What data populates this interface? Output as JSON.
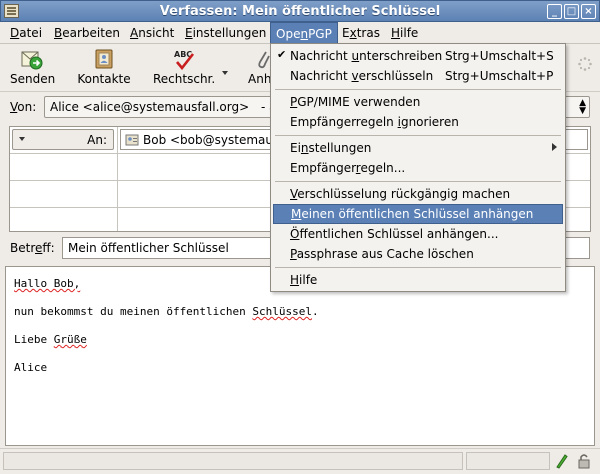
{
  "window": {
    "title": "Verfassen: Mein öffentlicher Schlüssel"
  },
  "menubar": {
    "items": [
      {
        "pre": "",
        "mn": "D",
        "post": "atei"
      },
      {
        "pre": "",
        "mn": "B",
        "post": "earbeiten"
      },
      {
        "pre": "",
        "mn": "A",
        "post": "nsicht"
      },
      {
        "pre": "",
        "mn": "E",
        "post": "instellungen"
      },
      {
        "pre": "Ope",
        "mn": "n",
        "post": "PGP"
      },
      {
        "pre": "E",
        "mn": "x",
        "post": "tras"
      },
      {
        "pre": "",
        "mn": "H",
        "post": "ilfe"
      }
    ]
  },
  "toolbar": {
    "send": "Senden",
    "contacts": "Kontakte",
    "spell": "Rechtschr.",
    "spell_icon_text": "ABC",
    "attach": "Anh"
  },
  "from": {
    "label_mn": "V",
    "label_rest": "on:",
    "value": "Alice <alice@systemausfall.org>",
    "suffix": "- a"
  },
  "recipients": {
    "type_label": "An:",
    "value": "Bob <bob@systemausf"
  },
  "subject": {
    "label_pre": "Betr",
    "label_mn": "e",
    "label_post": "ff:",
    "value": "Mein öffentlicher Schlüssel"
  },
  "body": {
    "line1": "Hallo Bob,",
    "line2_a": "nun bekommst du meinen öffentlichen ",
    "line2_b": "Schlüssel",
    "line2_c": ".",
    "line3_a": "Liebe ",
    "line3_b": "Grüße",
    "line4": "Alice"
  },
  "openpgp_menu": {
    "sign_pre": "Nachricht ",
    "sign_mn": "u",
    "sign_post": "nterschreiben",
    "sign_acc": "Strg+Umschalt+S",
    "encrypt_pre": "Nachricht ",
    "encrypt_mn": "v",
    "encrypt_post": "erschlüsseln",
    "encrypt_acc": "Strg+Umschalt+P",
    "pgpmime_pre": "",
    "pgpmime_mn": "P",
    "pgpmime_post": "GP/MIME verwenden",
    "ignore_pre": "Empfängerregeln ",
    "ignore_mn": "i",
    "ignore_post": "gnorieren",
    "settings_pre": "Ei",
    "settings_mn": "n",
    "settings_post": "stellungen",
    "rules_pre": "Empfänger",
    "rules_mn": "r",
    "rules_post": "egeln...",
    "undo_pre": "",
    "undo_mn": "V",
    "undo_post": "erschlüsselung rückgängig machen",
    "attach_mine_pre": "",
    "attach_mine_mn": "M",
    "attach_mine_post": "einen öffentlichen Schlüssel anhängen",
    "attach_pub_pre": "",
    "attach_pub_mn": "Ö",
    "attach_pub_post": "ffentlichen Schlüssel anhängen...",
    "clear_pre": "",
    "clear_mn": "P",
    "clear_post": "assphrase aus Cache löschen",
    "help_pre": "",
    "help_mn": "H",
    "help_post": "ilfe"
  },
  "colors": {
    "selection": "#5a80b6",
    "titlebar": "#6d90c0"
  }
}
